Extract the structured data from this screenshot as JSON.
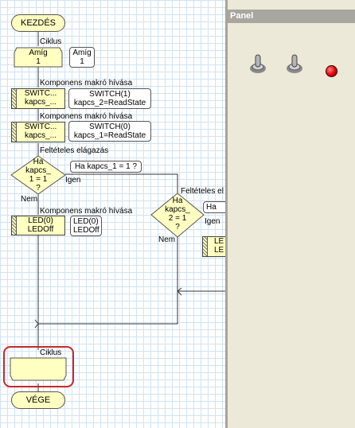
{
  "flowchart": {
    "start_label": "KEZDÉS",
    "end_label": "VÉGE",
    "loop": {
      "section_label": "Ciklus",
      "shape_label": "Amíg\n1",
      "bubble": "Amíg\n1"
    },
    "macro1": {
      "section_label": "Komponens makró hívása",
      "shape_label": "SWITC...\nkapcs_...",
      "bubble": "SWITCH(1)\nkapcs_2=ReadState"
    },
    "macro2": {
      "section_label": "Komponens makró hívása",
      "shape_label": "SWITC...\nkapcs_...",
      "bubble": "SWITCH(0)\nkapcs_1=ReadState"
    },
    "decision1": {
      "section_label": "Feltételes elágazás",
      "shape_label": "Ha\nkapcs_\n1 = 1\n?",
      "bubble": "Ha kapcs_1 = 1 ?",
      "yes_label": "Igen",
      "no_label": "Nem"
    },
    "macro3": {
      "section_label": "Komponens makró hívása",
      "shape_label": "LED(0)\nLEDOff",
      "bubble": "LED(0)\nLEDOff"
    },
    "decision2": {
      "section_label": "Feltételes el",
      "shape_label": "Ha\nkapcs_\n2 = 1\n?",
      "bubble": "Ha",
      "yes_label": "Igen",
      "no_label": "Nem"
    },
    "macro4": {
      "shape_label": "LE\nLE"
    },
    "loop_end": {
      "section_label": "Ciklus"
    }
  },
  "panel": {
    "title": "Panel",
    "led_color": "#e00000"
  },
  "highlight_color": "#c62828"
}
